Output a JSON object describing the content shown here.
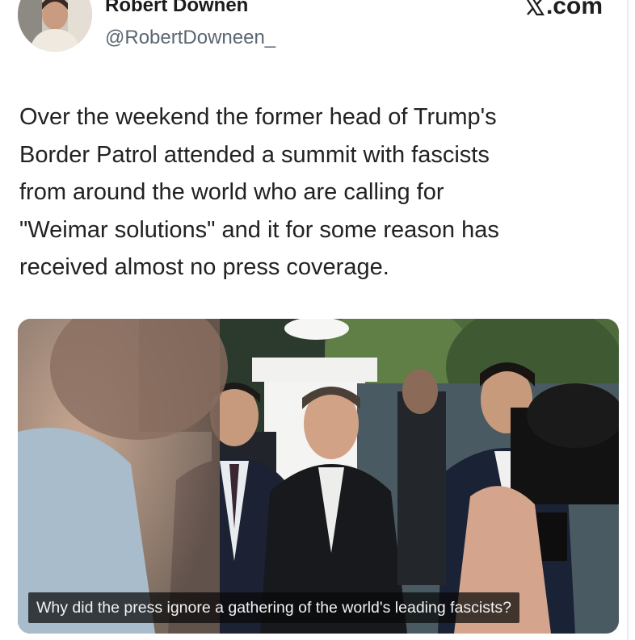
{
  "author": {
    "display_name": "Robert Downen",
    "handle": "@RobertDowneen_"
  },
  "source": {
    "logo_icon": "x-logo-icon",
    "label": ".com"
  },
  "tweet": {
    "text": "Over the weekend the former head of Trump's\nBorder Patrol attended a summit with fascists\nfrom around the world who are calling for\n\"Weimar solutions\" and it for some reason has\nreceived almost no press coverage."
  },
  "media": {
    "caption": "Why did the press ignore a gathering of the world's leading fascists?"
  },
  "colors": {
    "text": "#222222",
    "handle": "#5b6670",
    "caption_bg": "#141414"
  }
}
